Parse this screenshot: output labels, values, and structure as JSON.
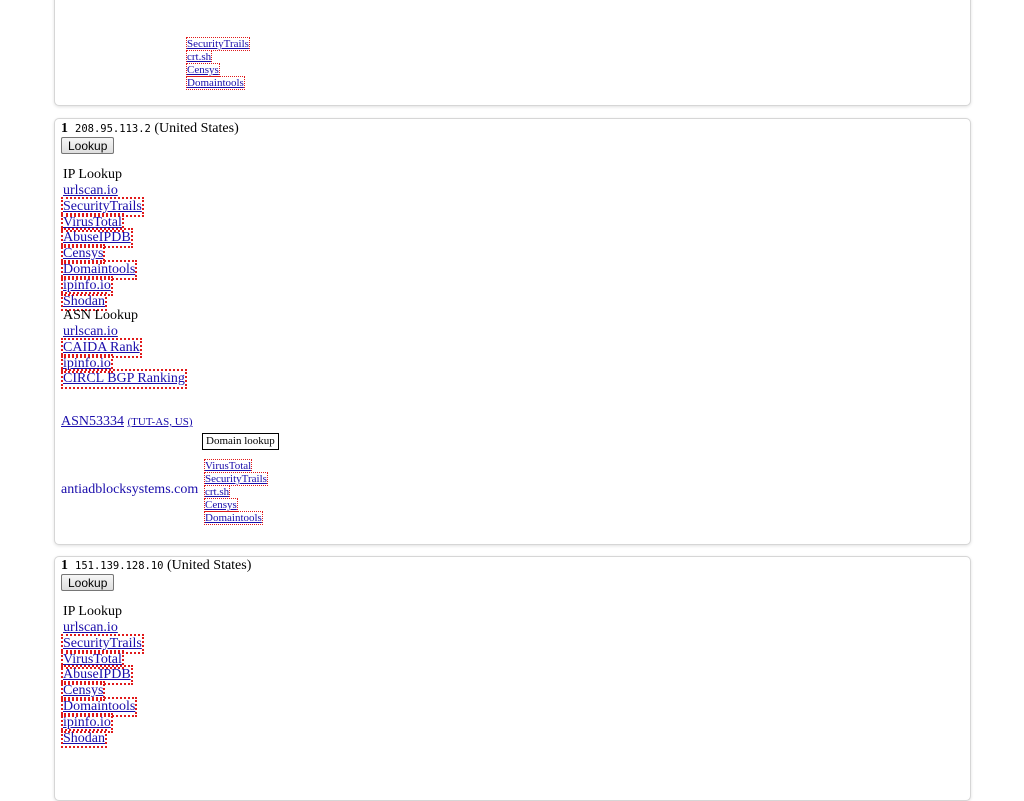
{
  "top_card": {
    "links": [
      "SecurityTrails",
      "crt.sh",
      "Censys",
      "Domaintools"
    ]
  },
  "results": [
    {
      "index": "1",
      "ip": "208.95.113.2",
      "country": "(United States)",
      "lookup_label": "Lookup",
      "ip_lookup_title": "IP Lookup",
      "ip_links": [
        "urlscan.io",
        "SecurityTrails",
        "VirusTotal",
        "AbuseIPDB",
        "Censys",
        "Domaintools",
        "ipinfo.io",
        "Shodan"
      ],
      "asn_lookup_title": "ASN Lookup",
      "asn_links": [
        "urlscan.io",
        "CAIDA Rank",
        "ipinfo.io",
        "CIRCL BGP Ranking"
      ],
      "asn": "ASN53334",
      "asn_org": "(TUT-AS, US)",
      "domain_lookup_label": "Domain lookup",
      "domain": "antiadblocksystems.com",
      "domain_links": [
        "VirusTotal",
        "SecurityTrails",
        "crt.sh",
        "Censys",
        "Domaintools"
      ]
    },
    {
      "index": "1",
      "ip": "151.139.128.10",
      "country": "(United States)",
      "lookup_label": "Lookup",
      "ip_lookup_title": "IP Lookup",
      "ip_links": [
        "urlscan.io",
        "SecurityTrails",
        "VirusTotal",
        "AbuseIPDB",
        "Censys",
        "Domaintools",
        "ipinfo.io",
        "Shodan"
      ]
    }
  ]
}
